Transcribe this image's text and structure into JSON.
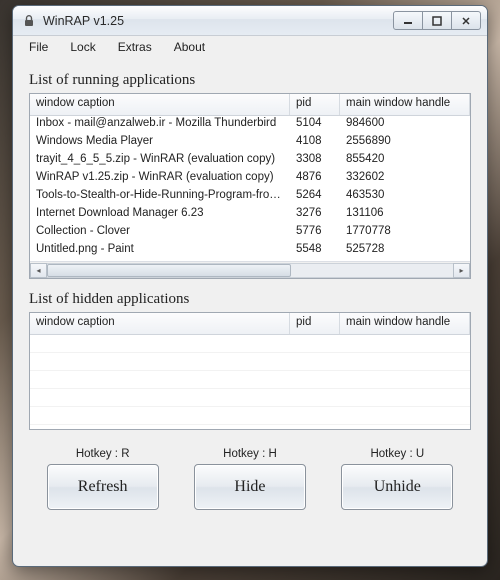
{
  "window": {
    "title": "WinRAP v1.25",
    "icon": "lock-icon"
  },
  "menu": [
    "File",
    "Lock",
    "Extras",
    "About"
  ],
  "running": {
    "title": "List of running applications",
    "columns": [
      "window caption",
      "pid",
      "main window handle"
    ],
    "rows": [
      {
        "caption": "Inbox - mail@anzalweb.ir - Mozilla Thunderbird",
        "pid": "5104",
        "handle": "984600"
      },
      {
        "caption": "Windows Media Player",
        "pid": "4108",
        "handle": "2556890"
      },
      {
        "caption": "trayit_4_6_5_5.zip - WinRAR (evaluation copy)",
        "pid": "3308",
        "handle": "855420"
      },
      {
        "caption": "WinRAP v1.25.zip - WinRAR (evaluation copy)",
        "pid": "4876",
        "handle": "332602"
      },
      {
        "caption": "Tools-to-Stealth-or-Hide-Running-Program-from-Ap...",
        "pid": "5264",
        "handle": "463530"
      },
      {
        "caption": "Internet Download Manager 6.23",
        "pid": "3276",
        "handle": "131106"
      },
      {
        "caption": "Collection - Clover",
        "pid": "5776",
        "handle": "1770778"
      },
      {
        "caption": "Untitled.png - Paint",
        "pid": "5548",
        "handle": "525728"
      }
    ]
  },
  "hidden": {
    "title": "List of hidden applications",
    "columns": [
      "window caption",
      "pid",
      "main window handle"
    ],
    "rows": []
  },
  "buttons": {
    "refresh": {
      "hotkey": "Hotkey : R",
      "label": "Refresh"
    },
    "hide": {
      "hotkey": "Hotkey : H",
      "label": "Hide"
    },
    "unhide": {
      "hotkey": "Hotkey : U",
      "label": "Unhide"
    }
  }
}
